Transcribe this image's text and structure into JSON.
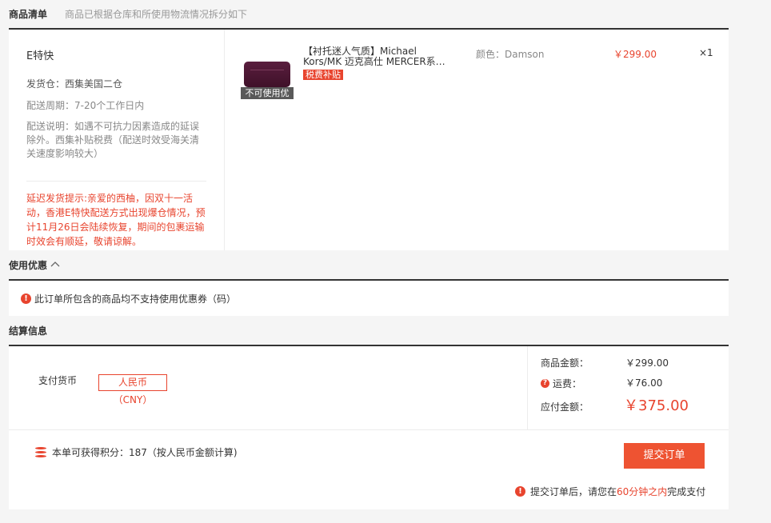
{
  "goods_section": {
    "title": "商品清单",
    "subtitle": "商品已根据仓库和所使用物流情况拆分如下"
  },
  "warehouse": {
    "name": "E特快",
    "ship_from": "发货仓：西集美国二仓",
    "period": "配送周期：7-20个工作日内",
    "note": "配送说明：如遇不可抗力因素造成的延误除外。西集补贴税费（配送时效受海关清关速度影响较大）",
    "delay_warning": "延迟发货提示:亲爱的西柚，因双十一活动，香港E特快配送方式出现爆仓情况，预计11月26日会陆续恢复，期间的包裹运输时效会有顺延，敬请谅解。"
  },
  "product": {
    "name": "【衬托迷人气质】Michael Kors/MK 迈克高仕 MERCER系…",
    "tag": "税费补贴",
    "no_coupon_badge": "不可使用优",
    "color": "颜色：Damson",
    "price": "￥299.00",
    "qty": "×1",
    "image_icon": "purple-wallet-bag"
  },
  "coupon_section": {
    "title": "使用优惠",
    "toggle_icon": "chevron-up",
    "message": "此订单所包含的商品均不支持使用优惠券（码）"
  },
  "settle_section": {
    "title": "结算信息",
    "currency_label": "支付货币",
    "currency": "人民币",
    "currency_code": "（CNY）",
    "goods_amount_label": "商品金额：",
    "goods_amount": "￥299.00",
    "shipping_label": "运费：",
    "shipping": "￥76.00",
    "payable_label": "应付金额：",
    "payable": "￥375.00",
    "points_text": "本单可获得积分：187（按人民币金额计算)",
    "submit_label": "提交订单",
    "note_prefix": "提交订单后，请您在",
    "note_time": "60分钟之内",
    "note_suffix": "完成支付"
  },
  "colors": {
    "accent": "#e8442e",
    "button": "#ee5332"
  }
}
